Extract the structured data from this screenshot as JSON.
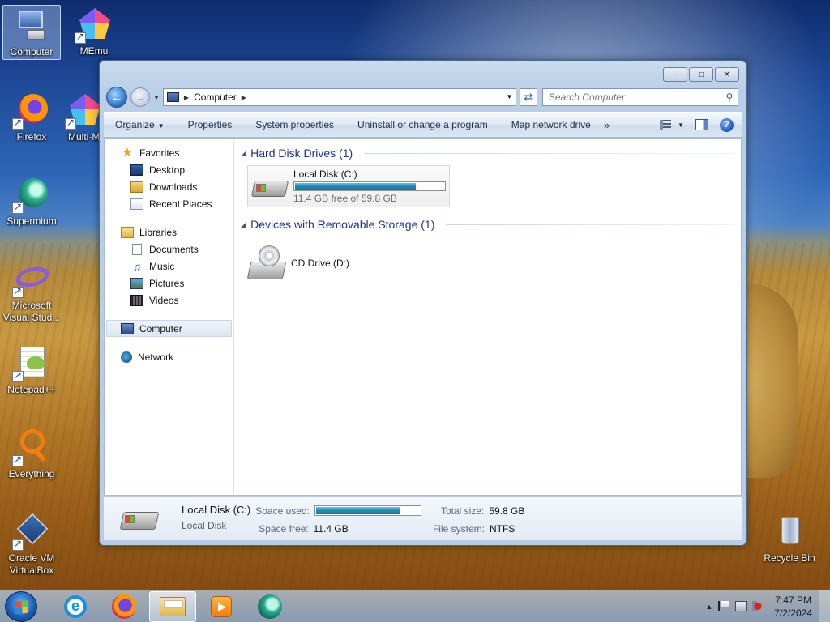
{
  "desktop": {
    "icons": [
      {
        "label": "Computer"
      },
      {
        "label": "MEmu"
      },
      {
        "label": "Firefox"
      },
      {
        "label": "Multi-M"
      },
      {
        "label": "Supermium"
      },
      {
        "label": "Microsoft Visual Stud..."
      },
      {
        "label": "Notepad++"
      },
      {
        "label": "Everything"
      },
      {
        "label": "Oracle VM VirtualBox"
      },
      {
        "label": "Recycle Bin"
      }
    ]
  },
  "window": {
    "controls": {
      "minimize": "–",
      "maximize": "□",
      "close": "✕"
    },
    "address": {
      "root": "Computer"
    },
    "search": {
      "placeholder": "Search Computer"
    },
    "toolbar": {
      "organize": "Organize",
      "properties": "Properties",
      "system_properties": "System properties",
      "uninstall": "Uninstall or change a program",
      "map_network": "Map network drive",
      "more": "»"
    },
    "nav": {
      "favorites": "Favorites",
      "desktop": "Desktop",
      "downloads": "Downloads",
      "recent": "Recent Places",
      "libraries": "Libraries",
      "documents": "Documents",
      "music": "Music",
      "pictures": "Pictures",
      "videos": "Videos",
      "computer": "Computer",
      "network": "Network"
    },
    "groups": {
      "hdd": "Hard Disk Drives (1)",
      "removable": "Devices with Removable Storage (1)"
    },
    "drives": {
      "c": {
        "name": "Local Disk (C:)",
        "free_text": "11.4 GB free of 59.8 GB",
        "used_fraction": 0.81
      },
      "d": {
        "name": "CD Drive (D:)"
      }
    },
    "details": {
      "name": "Local Disk (C:)",
      "type": "Local Disk",
      "space_used_label": "Space used:",
      "space_free_label": "Space free:",
      "space_free": "11.4 GB",
      "total_size_label": "Total size:",
      "total_size": "59.8 GB",
      "fs_label": "File system:",
      "fs": "NTFS"
    }
  },
  "taskbar": {
    "clock_time": "7:47 PM",
    "clock_date": "7/2/2024",
    "tray_up": "▲"
  }
}
